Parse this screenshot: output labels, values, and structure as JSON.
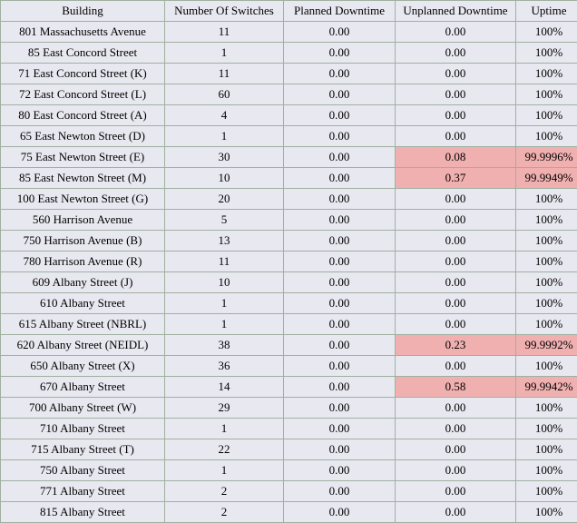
{
  "headers": {
    "building": "Building",
    "switches": "Number Of Switches",
    "planned": "Planned Downtime",
    "unplanned": "Unplanned Downtime",
    "uptime": "Uptime"
  },
  "rows": [
    {
      "building": "801 Massachusetts Avenue",
      "switches": "11",
      "planned": "0.00",
      "unplanned": "0.00",
      "uptime": "100%",
      "unplanned_flag": false,
      "uptime_flag": false
    },
    {
      "building": "85 East Concord Street",
      "switches": "1",
      "planned": "0.00",
      "unplanned": "0.00",
      "uptime": "100%",
      "unplanned_flag": false,
      "uptime_flag": false
    },
    {
      "building": "71 East Concord Street (K)",
      "switches": "11",
      "planned": "0.00",
      "unplanned": "0.00",
      "uptime": "100%",
      "unplanned_flag": false,
      "uptime_flag": false
    },
    {
      "building": "72 East Concord Street (L)",
      "switches": "60",
      "planned": "0.00",
      "unplanned": "0.00",
      "uptime": "100%",
      "unplanned_flag": false,
      "uptime_flag": false
    },
    {
      "building": "80 East Concord Street (A)",
      "switches": "4",
      "planned": "0.00",
      "unplanned": "0.00",
      "uptime": "100%",
      "unplanned_flag": false,
      "uptime_flag": false
    },
    {
      "building": "65 East Newton Street (D)",
      "switches": "1",
      "planned": "0.00",
      "unplanned": "0.00",
      "uptime": "100%",
      "unplanned_flag": false,
      "uptime_flag": false
    },
    {
      "building": "75 East Newton Street (E)",
      "switches": "30",
      "planned": "0.00",
      "unplanned": "0.08",
      "uptime": "99.9996%",
      "unplanned_flag": true,
      "uptime_flag": true
    },
    {
      "building": "85 East Newton Street (M)",
      "switches": "10",
      "planned": "0.00",
      "unplanned": "0.37",
      "uptime": "99.9949%",
      "unplanned_flag": true,
      "uptime_flag": true
    },
    {
      "building": "100 East Newton Street (G)",
      "switches": "20",
      "planned": "0.00",
      "unplanned": "0.00",
      "uptime": "100%",
      "unplanned_flag": false,
      "uptime_flag": false
    },
    {
      "building": "560 Harrison Avenue",
      "switches": "5",
      "planned": "0.00",
      "unplanned": "0.00",
      "uptime": "100%",
      "unplanned_flag": false,
      "uptime_flag": false
    },
    {
      "building": "750 Harrison Avenue (B)",
      "switches": "13",
      "planned": "0.00",
      "unplanned": "0.00",
      "uptime": "100%",
      "unplanned_flag": false,
      "uptime_flag": false
    },
    {
      "building": "780 Harrison Avenue (R)",
      "switches": "11",
      "planned": "0.00",
      "unplanned": "0.00",
      "uptime": "100%",
      "unplanned_flag": false,
      "uptime_flag": false
    },
    {
      "building": "609 Albany Street (J)",
      "switches": "10",
      "planned": "0.00",
      "unplanned": "0.00",
      "uptime": "100%",
      "unplanned_flag": false,
      "uptime_flag": false
    },
    {
      "building": "610 Albany Street",
      "switches": "1",
      "planned": "0.00",
      "unplanned": "0.00",
      "uptime": "100%",
      "unplanned_flag": false,
      "uptime_flag": false
    },
    {
      "building": "615 Albany Street (NBRL)",
      "switches": "1",
      "planned": "0.00",
      "unplanned": "0.00",
      "uptime": "100%",
      "unplanned_flag": false,
      "uptime_flag": false
    },
    {
      "building": "620 Albany Street (NEIDL)",
      "switches": "38",
      "planned": "0.00",
      "unplanned": "0.23",
      "uptime": "99.9992%",
      "unplanned_flag": true,
      "uptime_flag": true
    },
    {
      "building": "650 Albany Street (X)",
      "switches": "36",
      "planned": "0.00",
      "unplanned": "0.00",
      "uptime": "100%",
      "unplanned_flag": false,
      "uptime_flag": false
    },
    {
      "building": "670 Albany Street",
      "switches": "14",
      "planned": "0.00",
      "unplanned": "0.58",
      "uptime": "99.9942%",
      "unplanned_flag": true,
      "uptime_flag": true
    },
    {
      "building": "700 Albany Street (W)",
      "switches": "29",
      "planned": "0.00",
      "unplanned": "0.00",
      "uptime": "100%",
      "unplanned_flag": false,
      "uptime_flag": false
    },
    {
      "building": "710 Albany Street",
      "switches": "1",
      "planned": "0.00",
      "unplanned": "0.00",
      "uptime": "100%",
      "unplanned_flag": false,
      "uptime_flag": false
    },
    {
      "building": "715 Albany Street (T)",
      "switches": "22",
      "planned": "0.00",
      "unplanned": "0.00",
      "uptime": "100%",
      "unplanned_flag": false,
      "uptime_flag": false
    },
    {
      "building": "750 Albany Street",
      "switches": "1",
      "planned": "0.00",
      "unplanned": "0.00",
      "uptime": "100%",
      "unplanned_flag": false,
      "uptime_flag": false
    },
    {
      "building": "771 Albany Street",
      "switches": "2",
      "planned": "0.00",
      "unplanned": "0.00",
      "uptime": "100%",
      "unplanned_flag": false,
      "uptime_flag": false
    },
    {
      "building": "815 Albany Street",
      "switches": "2",
      "planned": "0.00",
      "unplanned": "0.00",
      "uptime": "100%",
      "unplanned_flag": false,
      "uptime_flag": false
    }
  ]
}
